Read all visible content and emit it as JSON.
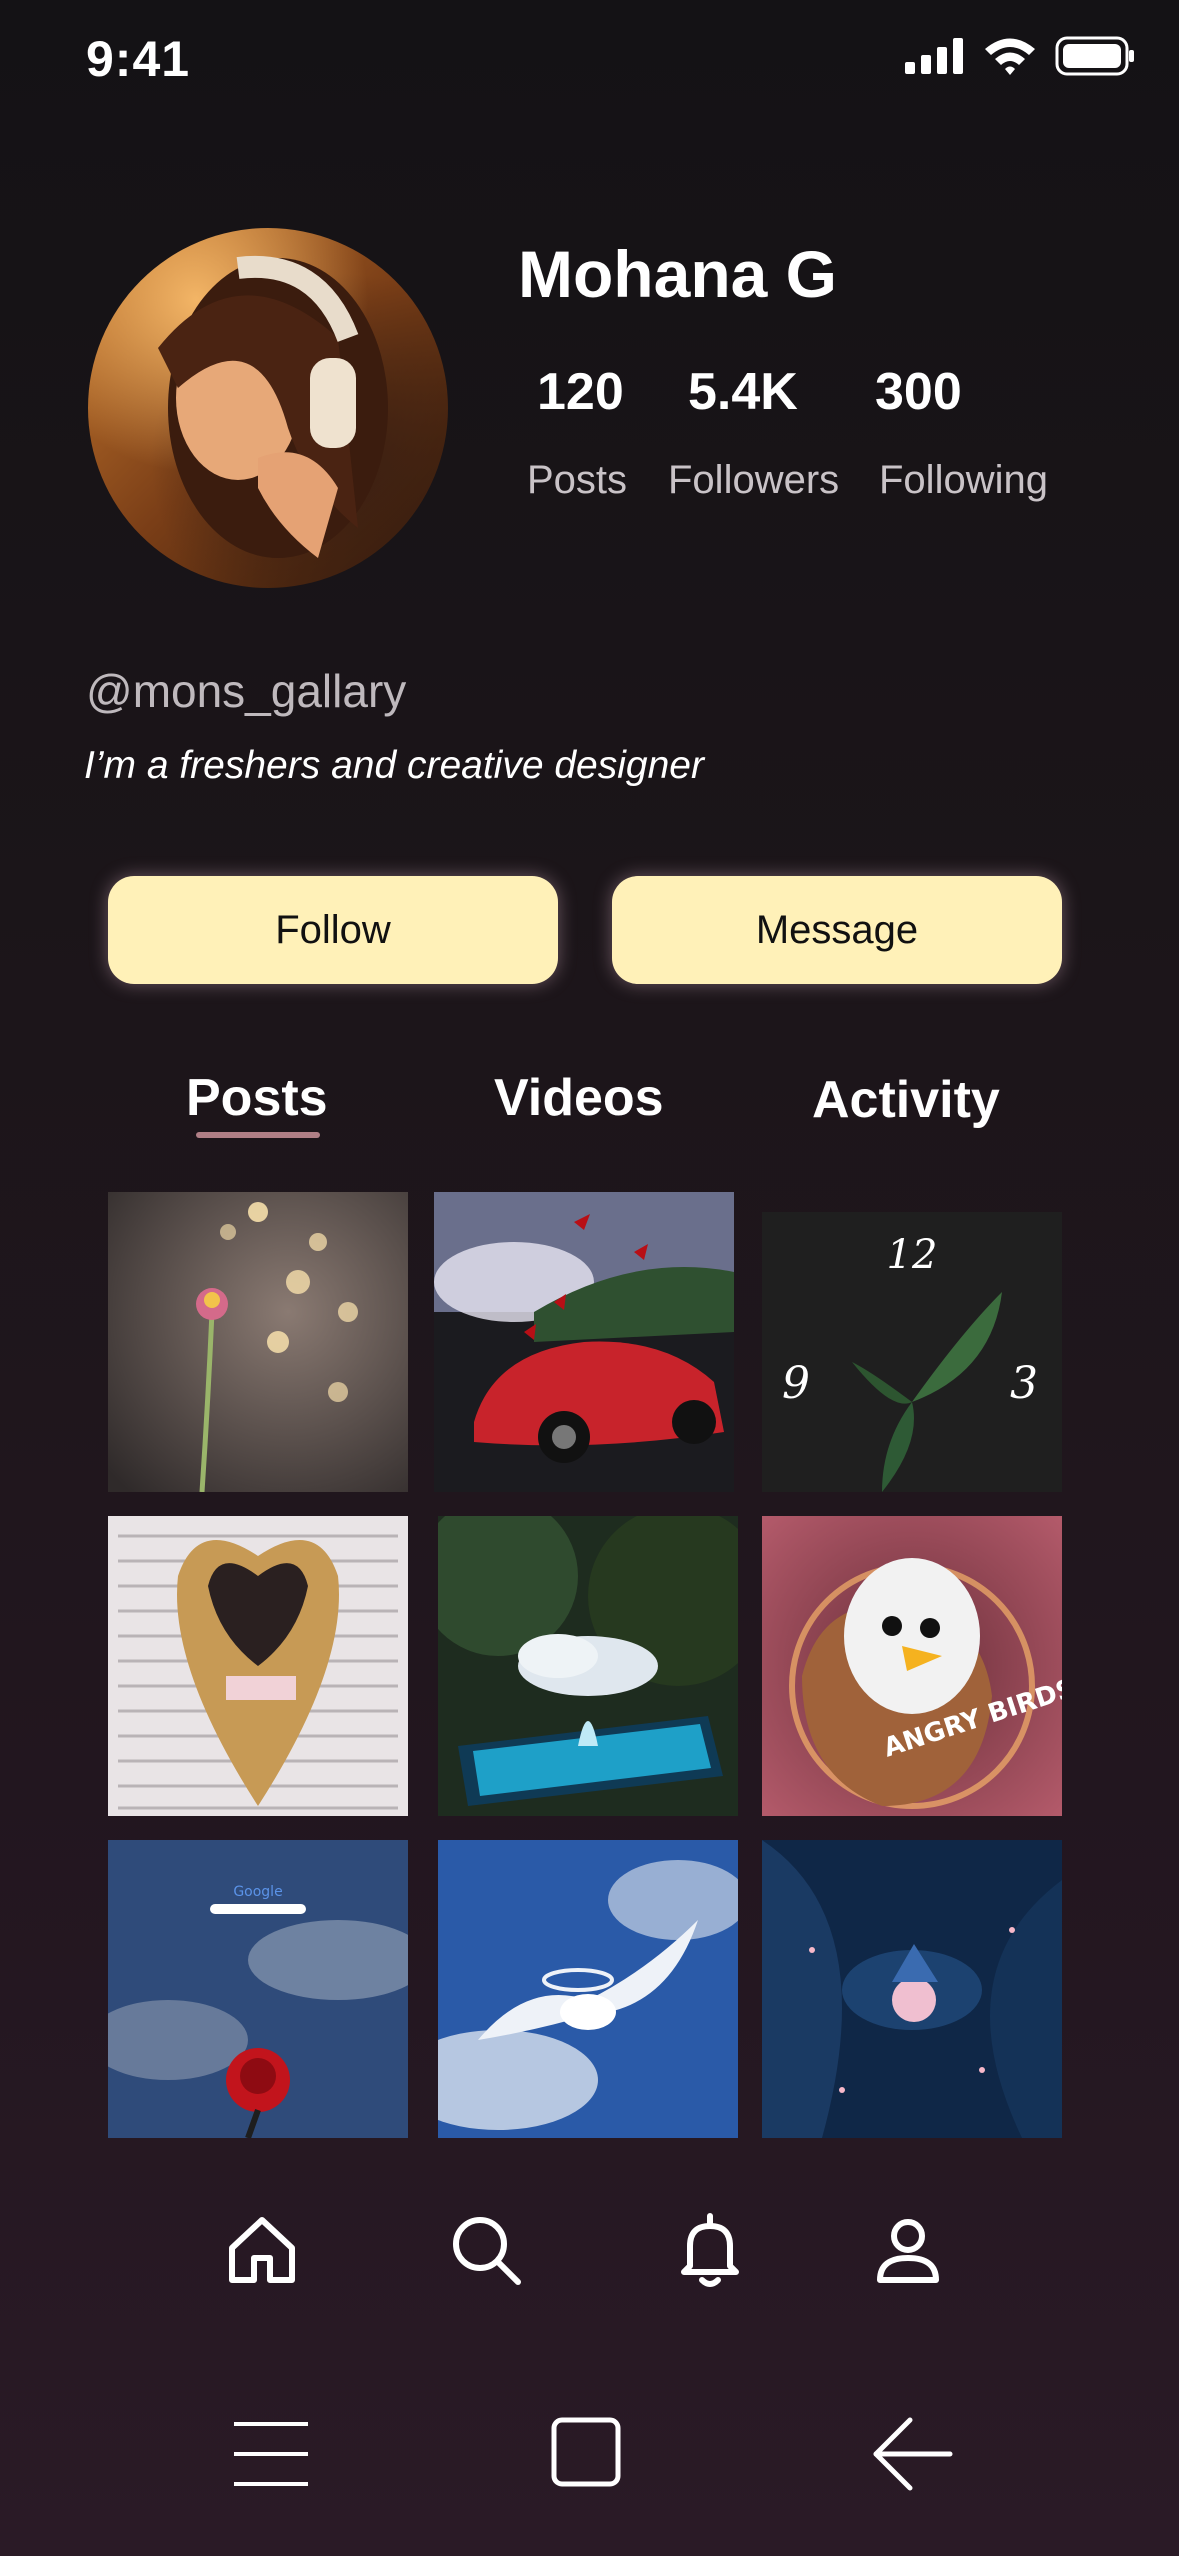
{
  "status_bar": {
    "time": "9:41"
  },
  "profile": {
    "name": "Mohana G",
    "stats": [
      {
        "value": "120",
        "label": "Posts"
      },
      {
        "value": "5.4K",
        "label": "Followers"
      },
      {
        "value": "300",
        "label": "Following"
      }
    ],
    "username": "@mons_gallary",
    "bio": "I’m a freshers and creative designer"
  },
  "actions": {
    "follow_label": "Follow",
    "message_label": "Message"
  },
  "tabs": [
    {
      "label": "Posts",
      "active": true
    },
    {
      "label": "Videos",
      "active": false
    },
    {
      "label": "Activity",
      "active": false
    }
  ],
  "grid": {
    "clock_labels": {
      "top": "12",
      "left": "9",
      "right": "3"
    },
    "search_engine_logo": "Google",
    "game_logo": "ANGRY BIRDS"
  },
  "bottom_nav": [
    "home-icon",
    "search-icon",
    "bell-icon",
    "profile-icon"
  ],
  "system_nav": [
    "menu-icon",
    "home-square-icon",
    "back-icon"
  ],
  "colors": {
    "button_bg": "#fff1b8",
    "active_tab_underline": "#b07f86",
    "background_top": "#141215",
    "background_bottom": "#2a1a26"
  }
}
